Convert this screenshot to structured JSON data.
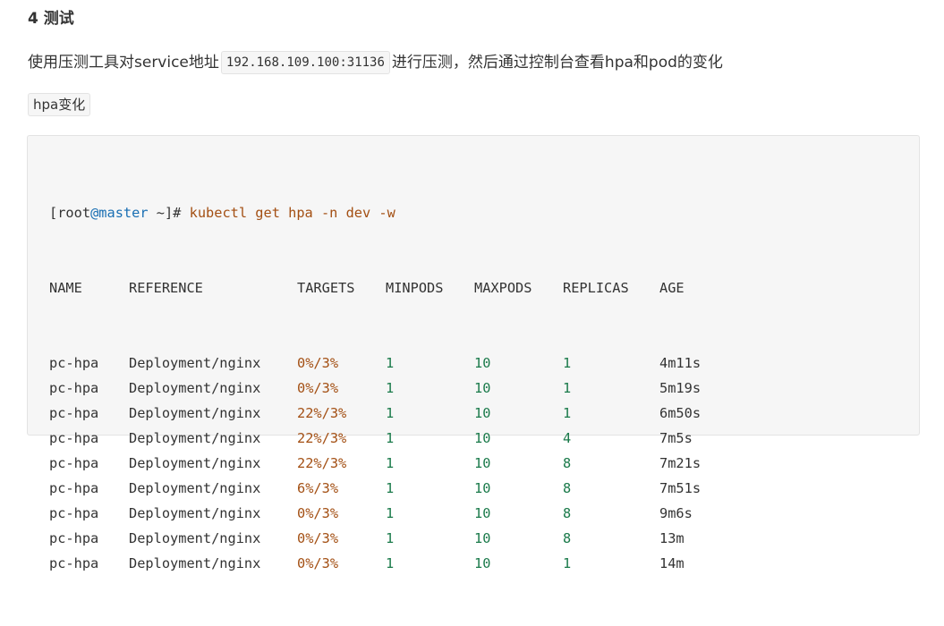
{
  "heading": "4 测试",
  "paragraph": {
    "before": "使用压测工具对service地址",
    "code": "192.168.109.100:31136",
    "after": "进行压测，然后通过控制台查看hpa和pod的变化"
  },
  "tag": "hpa变化",
  "terminal": {
    "prompt_open": "[",
    "prompt_user": "root",
    "prompt_at": "@",
    "prompt_host": "master",
    "prompt_dir": " ~",
    "prompt_close": "]# ",
    "command": "kubectl get hpa -n dev -w",
    "headers": [
      "NAME",
      "REFERENCE",
      "TARGETS",
      "MINPODS",
      "MAXPODS",
      "REPLICAS",
      "AGE"
    ],
    "rows": [
      {
        "name": "pc-hpa",
        "ref": "Deployment/nginx",
        "targets": "0%/3%",
        "minpods": "1",
        "maxpods": "10",
        "replicas": "1",
        "age": "4m11s"
      },
      {
        "name": "pc-hpa",
        "ref": "Deployment/nginx",
        "targets": "0%/3%",
        "minpods": "1",
        "maxpods": "10",
        "replicas": "1",
        "age": "5m19s"
      },
      {
        "name": "pc-hpa",
        "ref": "Deployment/nginx",
        "targets": "22%/3%",
        "minpods": "1",
        "maxpods": "10",
        "replicas": "1",
        "age": "6m50s"
      },
      {
        "name": "pc-hpa",
        "ref": "Deployment/nginx",
        "targets": "22%/3%",
        "minpods": "1",
        "maxpods": "10",
        "replicas": "4",
        "age": "7m5s"
      },
      {
        "name": "pc-hpa",
        "ref": "Deployment/nginx",
        "targets": "22%/3%",
        "minpods": "1",
        "maxpods": "10",
        "replicas": "8",
        "age": "7m21s"
      },
      {
        "name": "pc-hpa",
        "ref": "Deployment/nginx",
        "targets": "6%/3%",
        "minpods": "1",
        "maxpods": "10",
        "replicas": "8",
        "age": "7m51s"
      },
      {
        "name": "pc-hpa",
        "ref": "Deployment/nginx",
        "targets": "0%/3%",
        "minpods": "1",
        "maxpods": "10",
        "replicas": "8",
        "age": "9m6s"
      },
      {
        "name": "pc-hpa",
        "ref": "Deployment/nginx",
        "targets": "0%/3%",
        "minpods": "1",
        "maxpods": "10",
        "replicas": "8",
        "age": "13m"
      },
      {
        "name": "pc-hpa",
        "ref": "Deployment/nginx",
        "targets": "0%/3%",
        "minpods": "1",
        "maxpods": "10",
        "replicas": "1",
        "age": "14m"
      }
    ]
  },
  "colors": {
    "host": "#1a6fb3",
    "command": "#a34f13",
    "number": "#1a7a4a",
    "code_bg": "#f6f6f6"
  }
}
